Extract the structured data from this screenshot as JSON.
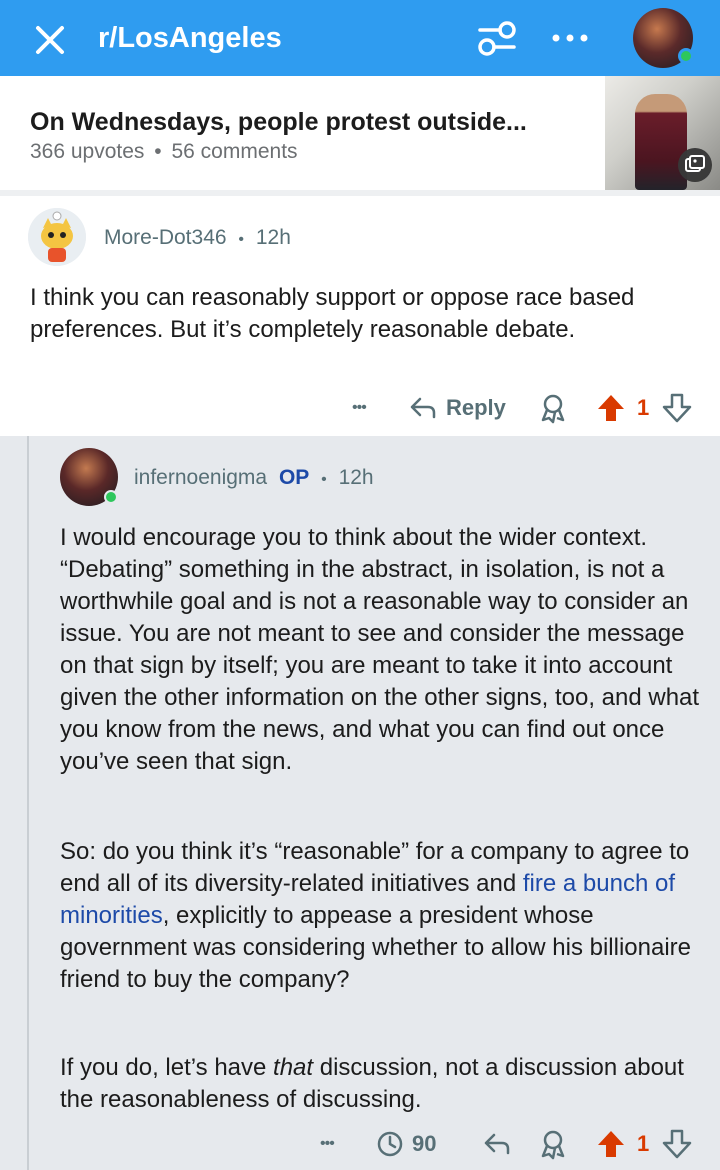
{
  "topbar": {
    "subreddit": "r/LosAngeles"
  },
  "post": {
    "title": "On Wednesdays, people protest outside...",
    "upvotes": "366 upvotes",
    "separator": "•",
    "comments": "56 comments"
  },
  "comment1": {
    "author": "More-Dot346",
    "separator": "•",
    "age": "12h",
    "body": "I think you can reasonably support or oppose race based preferences. But it’s completely reasonable debate.",
    "actions": {
      "more": "•••",
      "reply_label": "Reply",
      "vote_count": "1"
    }
  },
  "comment2": {
    "author": "infernoenigma",
    "op_badge": "OP",
    "separator": "•",
    "age": "12h",
    "para1": "I would encourage you to think about the wider context. “Debating” something in the abstract, in isolation, is not a worthwhile goal and is not a reasonable way to consider an issue. You are not meant to see and consider the message on that sign by itself; you are meant to take it into account given the other information on the other signs, too, and what you know from the news, and what you can find out once you’ve seen that sign.",
    "para2_before": "So: do you think it’s “reasonable” for a company to agree to end all of its diversity-related initiatives and ",
    "para2_link": "fire a bunch of minorities",
    "para2_after": ", explicitly to appease a president whose government was considering whether to allow his billionaire friend to buy the company?",
    "para3_before": "If you do, let’s have ",
    "para3_em": "that",
    "para3_after": " discussion, not a discussion about the reasonableness of discussing.",
    "actions": {
      "more": "•••",
      "timer_count": "90",
      "vote_count": "1"
    }
  },
  "colors": {
    "topbar": "#2f9cf0",
    "upvote": "#d93a00",
    "link": "#1d4aa8",
    "nested_bg": "#e6e9ed",
    "online": "#2ec75c"
  },
  "icons": [
    "close-icon",
    "filter-icon",
    "more-icon",
    "reply-icon",
    "award-icon",
    "upvote-icon",
    "downvote-icon",
    "timer-icon",
    "gallery-icon"
  ]
}
